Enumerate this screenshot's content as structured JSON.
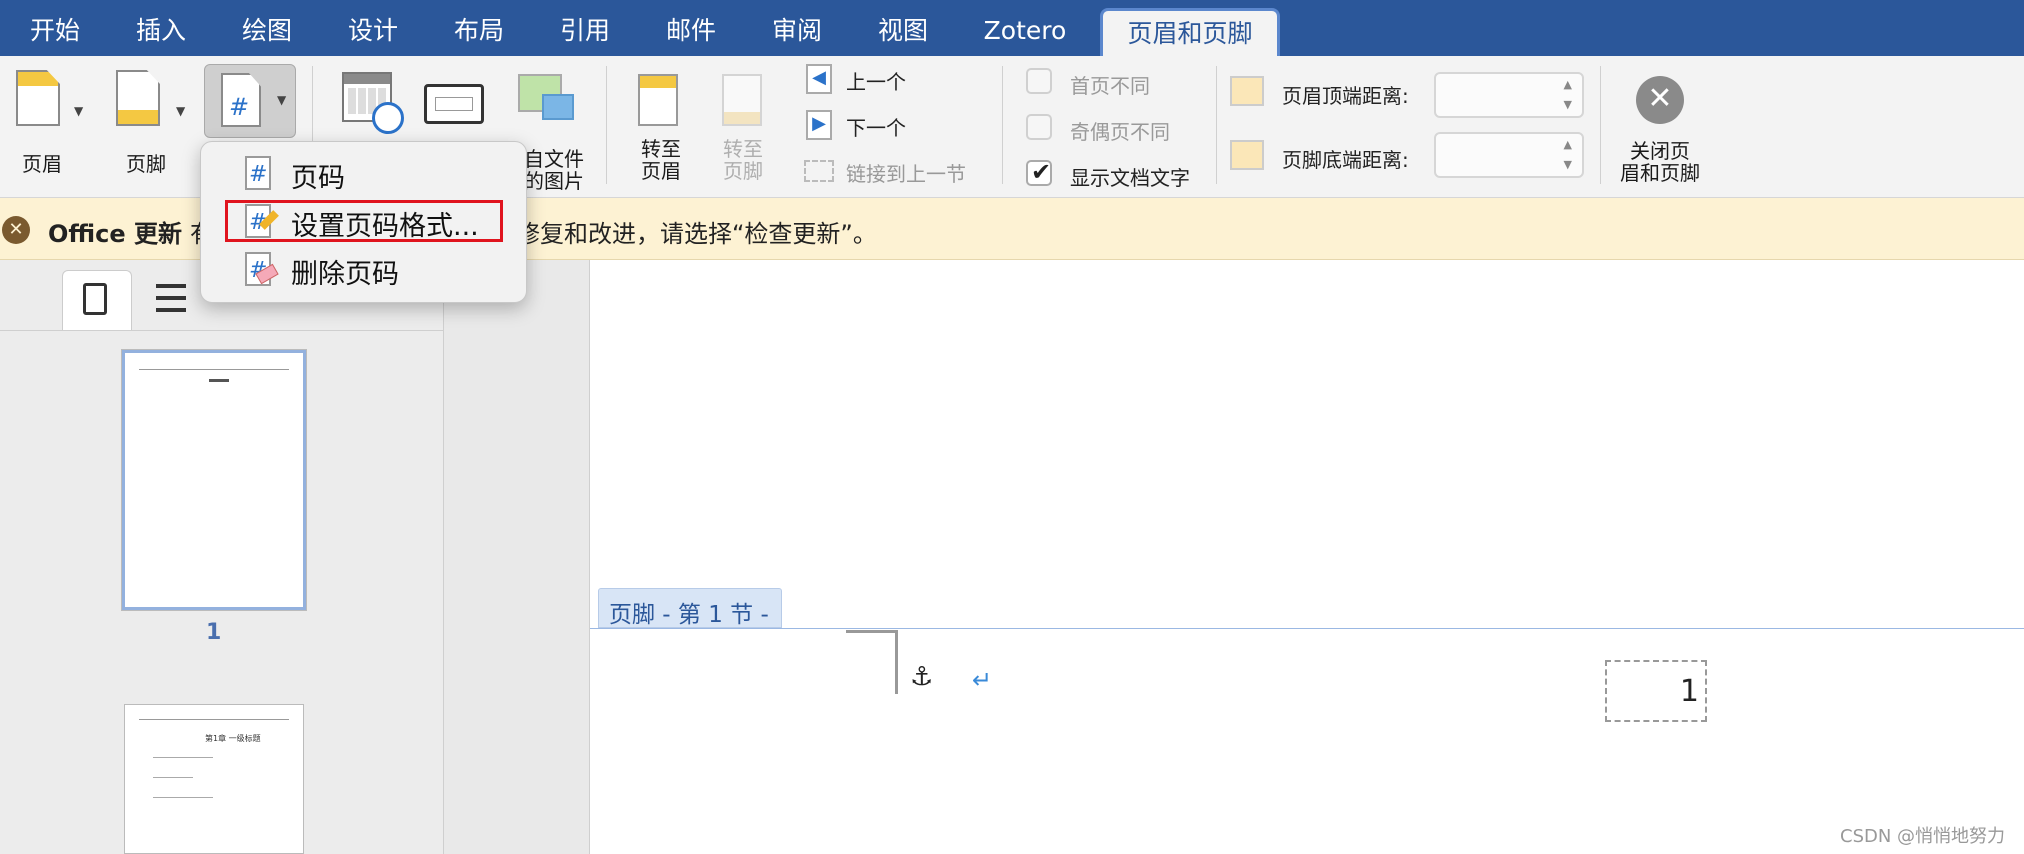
{
  "tabs": [
    {
      "label": "开始",
      "active": false
    },
    {
      "label": "插入",
      "active": false
    },
    {
      "label": "绘图",
      "active": false
    },
    {
      "label": "设计",
      "active": false
    },
    {
      "label": "布局",
      "active": false
    },
    {
      "label": "引用",
      "active": false
    },
    {
      "label": "邮件",
      "active": false
    },
    {
      "label": "审阅",
      "active": false
    },
    {
      "label": "视图",
      "active": false
    },
    {
      "label": "Zotero",
      "active": false
    },
    {
      "label": "页眉和页脚",
      "active": true
    }
  ],
  "ribbon": {
    "header": "页眉",
    "footer": "页脚",
    "picture_from_file": "自文件\n的图片",
    "goto_header": "转至\n页眉",
    "goto_footer": "转至\n页脚",
    "previous": "上一个",
    "next": "下一个",
    "link_to_previous": "链接到上一节",
    "different_first_page": "首页不同",
    "different_odd_even": "奇偶页不同",
    "show_document_text": "显示文档文字",
    "show_document_text_checked": true,
    "header_from_top": "页眉顶端距离:",
    "footer_from_bottom": "页脚底端距离:",
    "close": "关闭页\n眉和页脚"
  },
  "banner": {
    "title": "Office 更新",
    "text_visible_left": "有",
    "text_visible_right": "修复和改进，请选择“检查更新”。"
  },
  "dropdown": {
    "items": [
      "页码",
      "设置页码格式...",
      "删除页码"
    ],
    "highlighted": "设置页码格式..."
  },
  "sidebar": {
    "page_label": "1",
    "thumb2_heading": "第1章 一级标题"
  },
  "document": {
    "footer_tag": "页脚 - 第 1 节 -",
    "page_number": "1"
  },
  "watermark": "CSDN @悄悄地努力",
  "colors": {
    "accent": "#2b579a",
    "highlight_border": "#e0141e",
    "banner_bg": "#fdf2d3"
  }
}
